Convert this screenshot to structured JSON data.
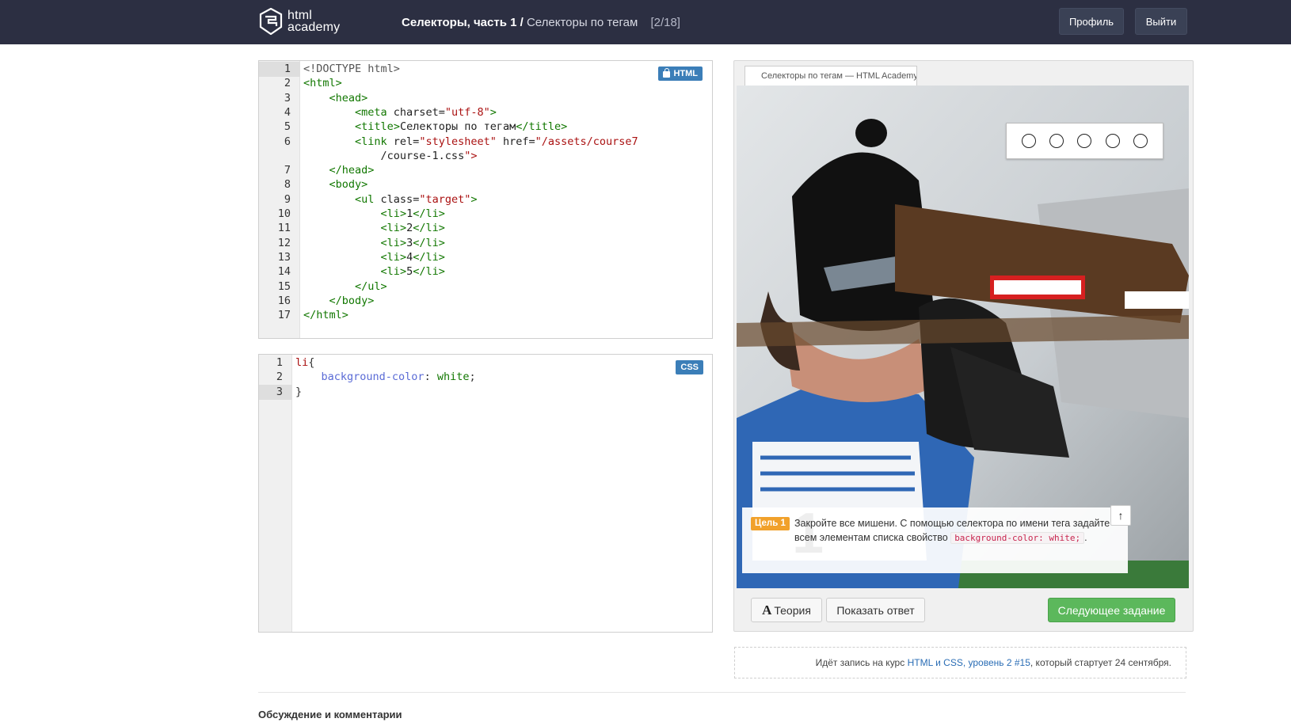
{
  "header": {
    "logo_line1": "html",
    "logo_line2": "academy",
    "lesson_part": "Селекторы, часть 1 /",
    "lesson_topic": "Селекторы по тегам",
    "lesson_counter": "[2/18]",
    "profile_label": "Профиль",
    "logout_label": "Выйти",
    "background_color": "#2c2f42"
  },
  "html_editor": {
    "badge": "HTML",
    "locked": true,
    "active_line": "1",
    "lines": [
      {
        "n": "1",
        "text": "<!DOCTYPE html>"
      },
      {
        "n": "2",
        "text": "<html>"
      },
      {
        "n": "3",
        "text": "    <head>"
      },
      {
        "n": "4",
        "text": "        <meta charset=\"utf-8\">"
      },
      {
        "n": "5",
        "text": "        <title>Селекторы по тегам</title>"
      },
      {
        "n": "6",
        "text": "        <link rel=\"stylesheet\" href=\"/assets/course7"
      },
      {
        "n": "",
        "text": "            /course-1.css\">"
      },
      {
        "n": "7",
        "text": "    </head>"
      },
      {
        "n": "8",
        "text": "    <body>"
      },
      {
        "n": "9",
        "text": "        <ul class=\"target\">"
      },
      {
        "n": "10",
        "text": "            <li>1</li>"
      },
      {
        "n": "11",
        "text": "            <li>2</li>"
      },
      {
        "n": "12",
        "text": "            <li>3</li>"
      },
      {
        "n": "13",
        "text": "            <li>4</li>"
      },
      {
        "n": "14",
        "text": "            <li>5</li>"
      },
      {
        "n": "15",
        "text": "        </ul>"
      },
      {
        "n": "16",
        "text": "    </body>"
      },
      {
        "n": "17",
        "text": "</html>"
      }
    ]
  },
  "css_editor": {
    "badge": "CSS",
    "active_line": "3",
    "lines": [
      {
        "n": "1",
        "text": "li{"
      },
      {
        "n": "2",
        "text": "    background-color: white;"
      },
      {
        "n": "3",
        "text": "}"
      }
    ]
  },
  "preview": {
    "tab_title": "Селекторы по тегам — HTML Academy",
    "targets": [
      "",
      "",
      "",
      "",
      ""
    ],
    "goal_label": "Цель 1",
    "goal_text": "Закройте все мишени. С помощью селектора по имени тега задайте всем элементам списка свойство",
    "goal_code": "background-color: white;",
    "goal_tail": ".",
    "collapse_icon": "arrow-up-icon",
    "theory_icon_glyph": "A",
    "theory_label": "Теория",
    "answer_label": "Показать ответ",
    "next_label": "Следующее задание",
    "next_color": "#5cb85c"
  },
  "promo": {
    "prefix": "Идёт запись на курс ",
    "course_link": "HTML и CSS, уровень 2 #15",
    "suffix": ", который стартует 24 сентября."
  },
  "comments": {
    "title": "Обсуждение и комментарии"
  }
}
